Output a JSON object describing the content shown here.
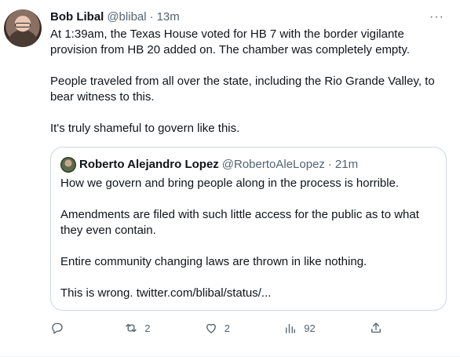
{
  "tweet": {
    "author": {
      "name": "Bob Libal",
      "handle": "@blibal",
      "time": "13m"
    },
    "paragraphs": [
      "At 1:39am, the Texas House voted for HB 7 with the border vigilante provision from HB 20 added on. The chamber was completely empty.",
      "People traveled from all over the state, including the Rio Grande Valley, to bear witness to this.",
      "It's truly shameful to govern like this."
    ],
    "more_label": "···",
    "separator": "·"
  },
  "quote": {
    "author": {
      "name": "Roberto Alejandro Lopez",
      "handle": "@RobertoAleLopez",
      "time": "21m"
    },
    "separator": "·",
    "paragraphs": [
      "How we govern and bring people along in the process is horrible.",
      "Amendments are filed with such little access for the public as to what they even contain.",
      "Entire community changing laws are thrown in like nothing.",
      "This is wrong. twitter.com/blibal/status/..."
    ]
  },
  "actions": {
    "reply": {
      "icon": "reply-icon",
      "count": ""
    },
    "retweet": {
      "icon": "retweet-icon",
      "count": "2"
    },
    "like": {
      "icon": "heart-icon",
      "count": "2"
    },
    "views": {
      "icon": "views-icon",
      "count": "92"
    },
    "share": {
      "icon": "share-icon",
      "count": ""
    }
  },
  "colors": {
    "text": "#0f1419",
    "secondary": "#536471",
    "border": "#cfd9de"
  }
}
